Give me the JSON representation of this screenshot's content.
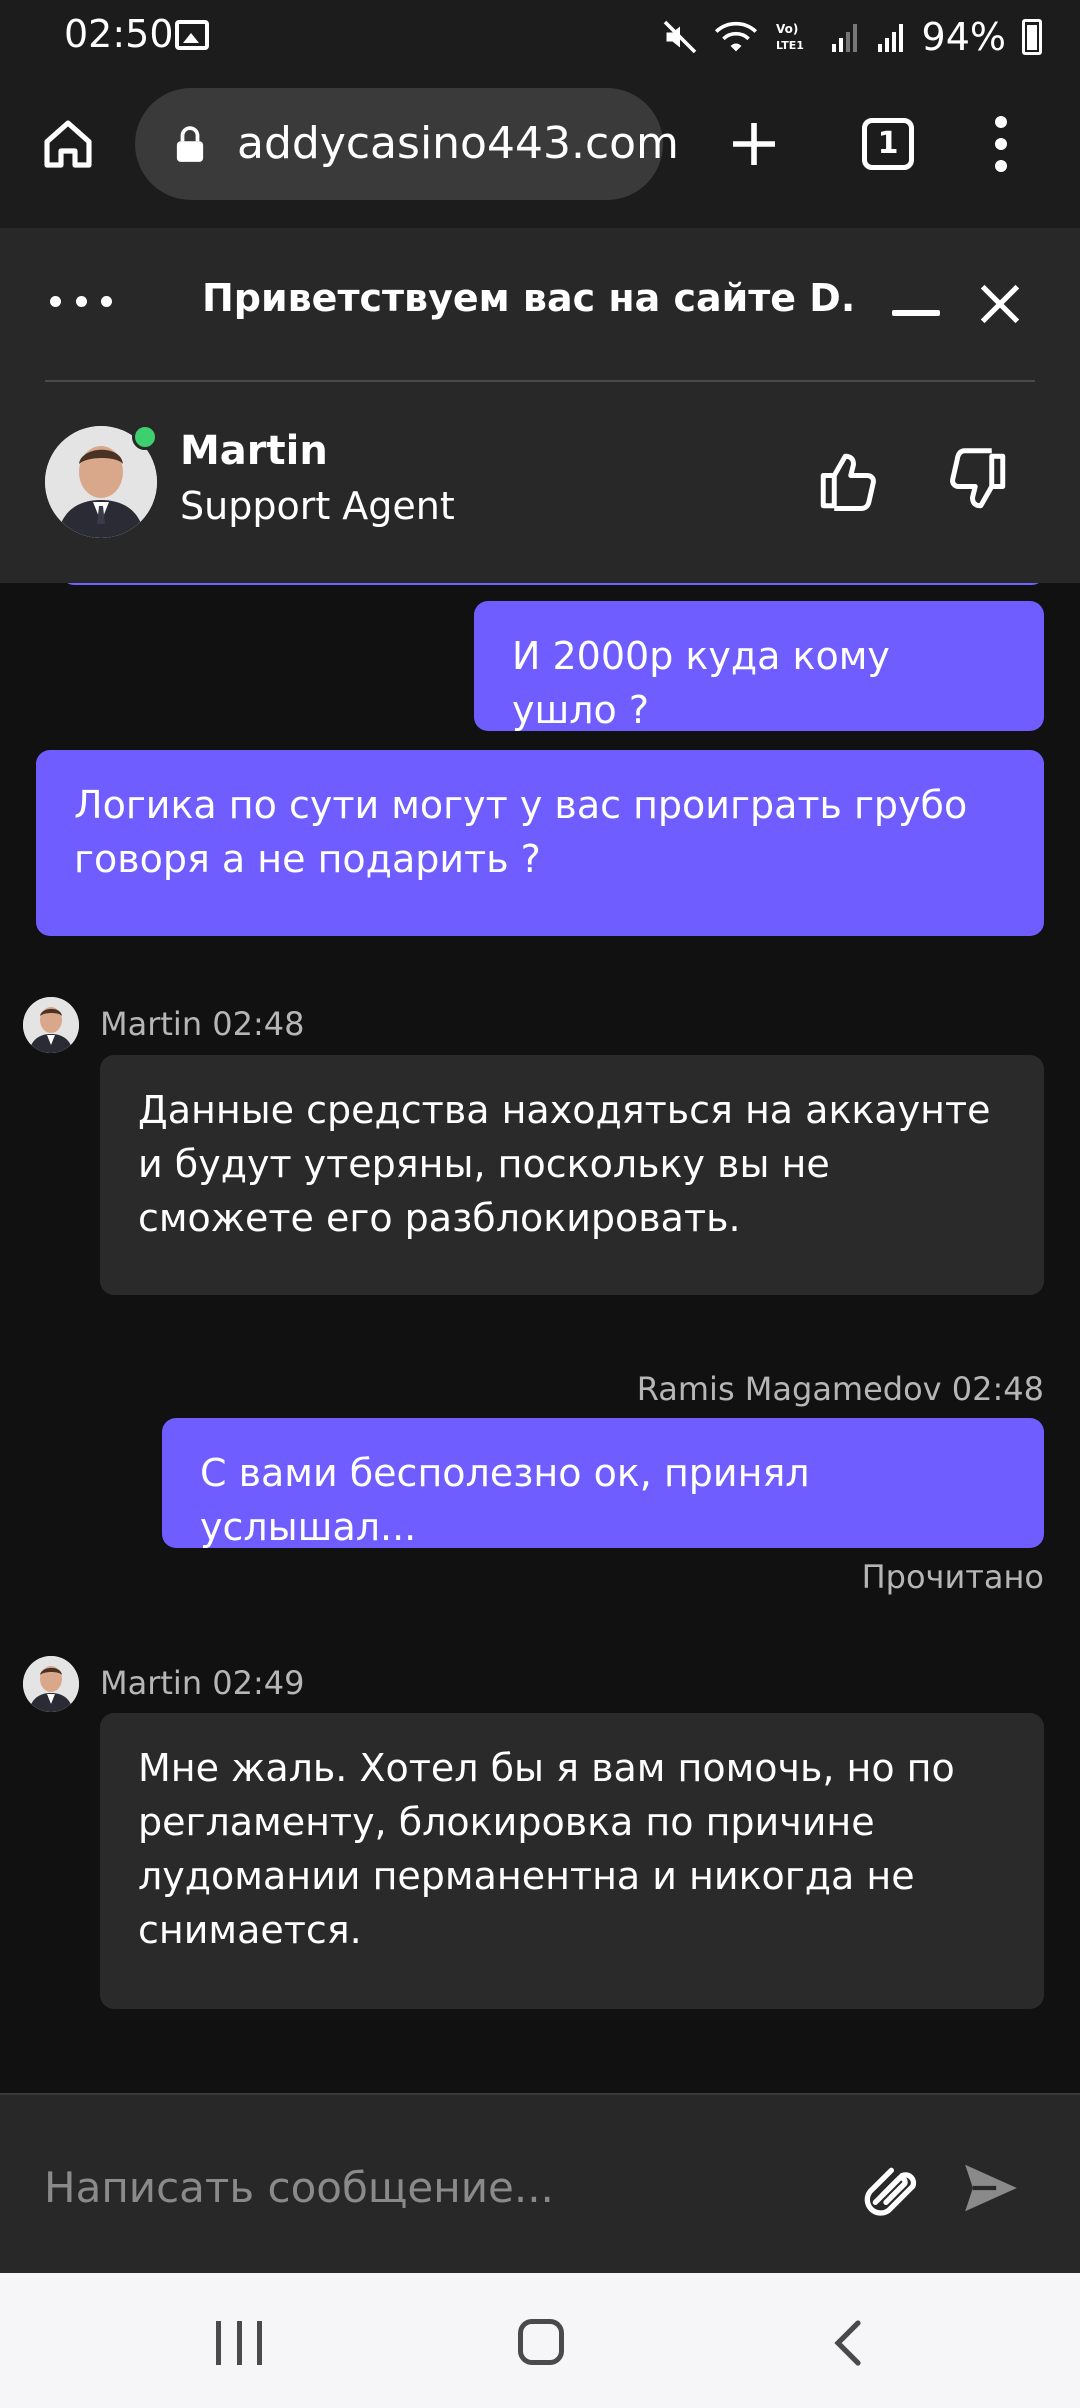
{
  "status_bar": {
    "time": "02:50",
    "battery": "94%"
  },
  "browser": {
    "url": "addycasino443.com",
    "tab_count": "1"
  },
  "chat": {
    "title": "Приветствуем вас на сайте D...",
    "agent": {
      "name": "Martin",
      "role": "Support Agent"
    }
  },
  "messages": {
    "m1": {
      "text": "И 2000р куда кому ушло ?"
    },
    "m2": {
      "text": "Логика по сути могут у вас проиграть грубо говоря а не подарить ?"
    },
    "m3": {
      "meta": "Martin 02:48",
      "text": "Данные средства находяться на аккаунте и будут утеряны, поскольку вы не сможете его разблокировать."
    },
    "m4": {
      "meta": "Ramis Magamedov 02:48",
      "text": "С вами бесполезно ок, принял услышал...",
      "status": "Прочитано"
    },
    "m5": {
      "meta": "Martin 02:49",
      "text": "Мне жаль. Хотел бы я вам помочь, но по регламенту, блокировка по причине лудомании перманентна и никогда не снимается."
    }
  },
  "composer": {
    "placeholder": "Написать сообщение..."
  },
  "colors": {
    "user_bubble": "#705dff",
    "agent_bubble": "#2a2a2a",
    "online": "#3ecf6e"
  }
}
